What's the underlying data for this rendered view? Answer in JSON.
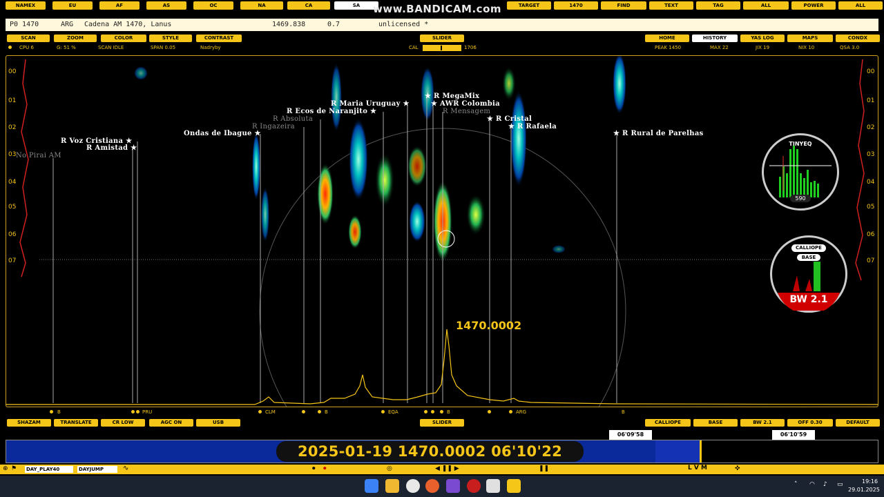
{
  "top_buttons": [
    "NAMEX",
    "EU",
    "AF",
    "AS",
    "OC",
    "NA",
    "CA",
    "SA"
  ],
  "top_buttons_right": [
    "TARGET",
    "1470",
    "FIND",
    "TEXT",
    "TAG",
    "ALL",
    "POWER",
    "ALL"
  ],
  "watermark": "www.BANDICAM.com",
  "info_line": {
    "code": "P0 1470",
    "country": "ARG",
    "station": "Cadena AM 1470, Lanus",
    "freq": "1469.838",
    "dist": "0.7",
    "status": "unlicensed *"
  },
  "left_buttons": [
    "SCAN",
    "ZOOM",
    "COLOR",
    "STYLE",
    "CONTRAST"
  ],
  "slider_label": "SLIDER",
  "right_buttons": [
    "HOME",
    "HISTORY",
    "YAS LOG",
    "MAPS",
    "CONDX"
  ],
  "status": {
    "cpu": "CPU 6",
    "g": "G: 51 %",
    "scan": "SCAN IDLE",
    "span": "SPAN 0.05",
    "name": "Nadryby",
    "cal": "CAL",
    "cal_val": "1706",
    "peak": "PEAK 1450",
    "max": "MAX 22",
    "jix": "JIX 19",
    "nix": "NIX 10",
    "qsa": "QSA 3.0"
  },
  "y_labels": [
    "00",
    "01",
    "02",
    "03",
    "04",
    "05",
    "06",
    "07"
  ],
  "stations": [
    {
      "name": "R MegaMix",
      "dim": false
    },
    {
      "name": "R Maria Uruguay",
      "dim": false
    },
    {
      "name": "AWR Colombia",
      "dim": false
    },
    {
      "name": "R Ecos de Naranjito",
      "dim": false
    },
    {
      "name": "R Mensagem",
      "dim": true
    },
    {
      "name": "R Absoluta",
      "dim": true
    },
    {
      "name": "R Cristal",
      "dim": false
    },
    {
      "name": "R Ingazeira",
      "dim": true
    },
    {
      "name": "R Rafaela",
      "dim": false
    },
    {
      "name": "Ondas de Ibague",
      "dim": false
    },
    {
      "name": "R Rural de Parelhas",
      "dim": false
    },
    {
      "name": "R Voz Cristiana",
      "dim": false
    },
    {
      "name": "R Amistad",
      "dim": false
    },
    {
      "name": "No Pirai AM",
      "dim": true
    }
  ],
  "peak_freq": "1470.0002",
  "x_labels": [
    "B",
    "PRU",
    "CLM",
    "B",
    "EQA",
    "B",
    "ARG",
    "B"
  ],
  "gauge1": {
    "title": "TINYEQ",
    "value": "590"
  },
  "gauge2": {
    "title": "CALLIOPE",
    "sub": "BASE",
    "bw": "BW 2.1"
  },
  "bottom_left_buttons": [
    "SHAZAM",
    "TRANSLATE",
    "CR LOW",
    "AGC ON",
    "USB"
  ],
  "bottom_right_buttons": [
    "CALLIOPE",
    "BASE",
    "BW 2.1",
    "OFF 0.30",
    "DEFAULT"
  ],
  "timeline": {
    "t1": "06'09'58",
    "t2": "06'10'59"
  },
  "date_display": "2025-01-19   1470.0002   06'10'22",
  "bottom_bar": {
    "day": "DAY_PLAY40",
    "jump": "DAYJUMP",
    "right": "L V M"
  },
  "clock": {
    "time": "19:16",
    "date": "29.01.2025"
  },
  "colors": {
    "accent": "#f5c518",
    "band": "#0a2a9c"
  }
}
